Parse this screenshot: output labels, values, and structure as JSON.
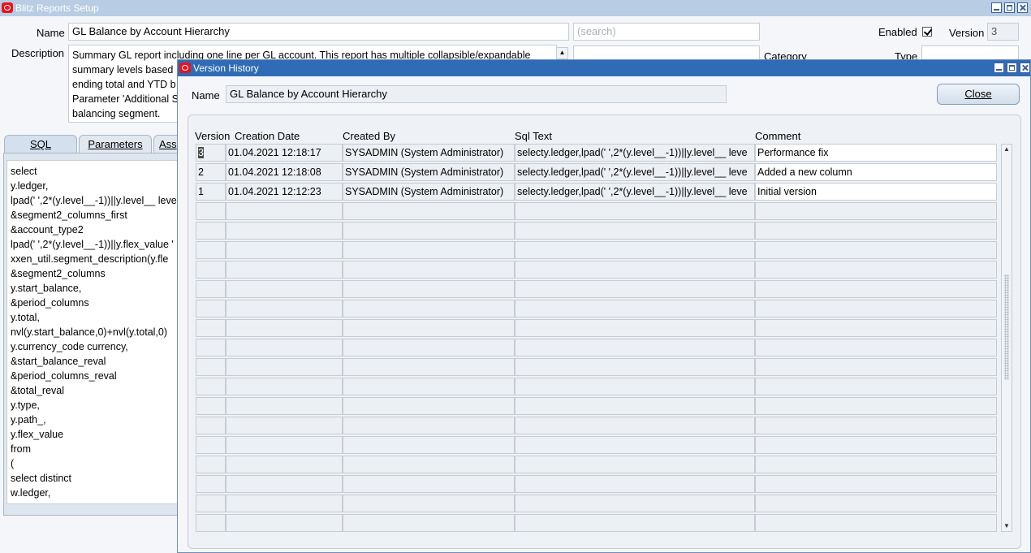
{
  "background_window": {
    "title": "Blitz Reports Setup",
    "name_label": "Name",
    "name_value": "GL Balance by Account Hierarchy",
    "search_placeholder": "(search)",
    "enabled_label": "Enabled",
    "enabled_checked": true,
    "version_label": "Version",
    "version_value": "3",
    "description_label": "Description",
    "description_lines": [
      "Summary GL report including one line per GL account. This report has multiple collapsible/expandable",
      "summary levels based",
      "ending total and YTD b",
      "Parameter 'Additional S",
      "balancing segment."
    ],
    "category_label": "Category",
    "type_label": "Type",
    "tabs": [
      {
        "label": "SQL",
        "active": true
      },
      {
        "label": "Parameters",
        "active": false
      },
      {
        "label": "Ass",
        "active": false
      }
    ],
    "sql_lines": [
      "select",
      "y.ledger,",
      "lpad(' ',2*(y.level__-1))||y.level__ leve",
      "&segment2_columns_first",
      "&account_type2",
      "lpad(' ',2*(y.level__-1))||y.flex_value '",
      "xxen_util.segment_description(y.fle",
      "&segment2_columns",
      "y.start_balance,",
      "&period_columns",
      "y.total,",
      "nvl(y.start_balance,0)+nvl(y.total,0)",
      "y.currency_code currency,",
      "&start_balance_reval",
      "&period_columns_reval",
      "&total_reval",
      "y.type,",
      "y.path_,",
      "y.flex_value",
      "from",
      "(",
      "select distinct",
      "w.ledger,"
    ]
  },
  "version_history": {
    "title": "Version History",
    "name_label": "Name",
    "name_value": "GL Balance by Account Hierarchy",
    "close_label": "Close",
    "columns": [
      "Version",
      "Creation Date",
      "Created By",
      "Sql Text",
      "Comment"
    ],
    "rows": [
      {
        "version": "3",
        "date": "01.04.2021 12:18:17",
        "by": "SYSADMIN (System Administrator)",
        "sql": "selecty.ledger,lpad(' ',2*(y.level__-1))||y.level__ leve",
        "comment": "Performance fix"
      },
      {
        "version": "2",
        "date": "01.04.2021 12:18:08",
        "by": "SYSADMIN (System Administrator)",
        "sql": "selecty.ledger,lpad(' ',2*(y.level__-1))||y.level__ leve",
        "comment": "Added a new column"
      },
      {
        "version": "1",
        "date": "01.04.2021 12:12:23",
        "by": "SYSADMIN (System Administrator)",
        "sql": "selecty.ledger,lpad(' ',2*(y.level__-1))||y.level__ leve",
        "comment": "Initial version"
      }
    ],
    "empty_rows": 17
  },
  "colors": {
    "active_title": "#2f6cb5",
    "inactive_title": "#b8cde4",
    "oracle_red": "#e8141c"
  }
}
